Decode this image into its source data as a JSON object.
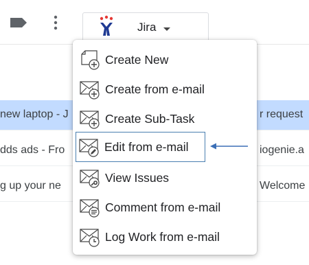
{
  "toolbar": {
    "tag_icon": "label-icon",
    "more_icon": "more-vert-icon",
    "jira_button": {
      "label": "Jira",
      "logo": "jira-logo",
      "caret": "caret-down-icon"
    }
  },
  "email_rows": [
    {
      "left_text": "new laptop - J",
      "right_text": "r request",
      "selected": true
    },
    {
      "left_text": "dds ads - Fro",
      "right_text": "iogenie.a",
      "selected": false
    },
    {
      "left_text": "g up your ne",
      "right_text": "Welcome",
      "selected": false
    }
  ],
  "jira_menu": {
    "items": [
      {
        "label": "Create New",
        "icon": "create-new-icon"
      },
      {
        "label": "Create from e-mail",
        "icon": "create-from-email-icon"
      },
      {
        "label": "Create Sub-Task",
        "icon": "create-subtask-icon"
      },
      {
        "label": "Edit from e-mail",
        "icon": "edit-from-email-icon",
        "highlighted": true
      },
      {
        "label": "View Issues",
        "icon": "view-issues-icon"
      },
      {
        "label": "Comment from e-mail",
        "icon": "comment-from-email-icon"
      },
      {
        "label": "Log Work from e-mail",
        "icon": "log-work-from-email-icon"
      }
    ]
  },
  "annotation": {
    "arrow": "left-arrow-icon",
    "color": "#3b6fb6"
  }
}
